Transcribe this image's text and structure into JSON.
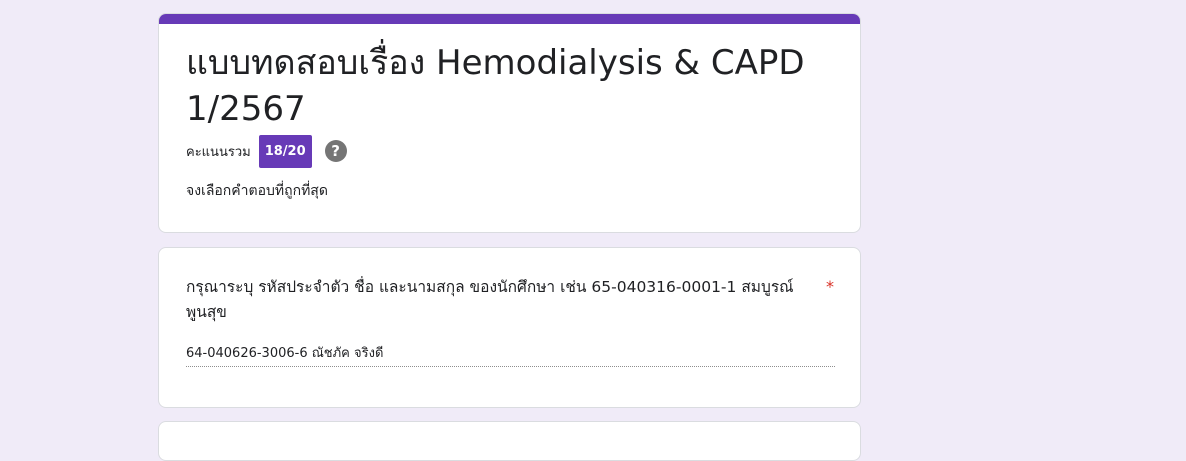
{
  "form": {
    "title": "แบบทดสอบเรื่อง Hemodialysis & CAPD 1/2567",
    "total_score_label": "คะแนนรวม",
    "score": "18/20",
    "description": "จงเลือกคำตอบที่ถูกที่สุด",
    "accent_color": "#673ab7",
    "background_color": "#f0ebf8"
  },
  "question": {
    "text": "กรุณาระบุ รหัสประจำตัว ชื่อ และนามสกุล ของนักศึกษา เช่น 65-040316-0001-1 สมบูรณ์ พูนสุข",
    "required_marker": "*",
    "answer": "64-040626-3006-6 ณัชภัค จริงดี"
  },
  "icons": {
    "help": "?"
  }
}
